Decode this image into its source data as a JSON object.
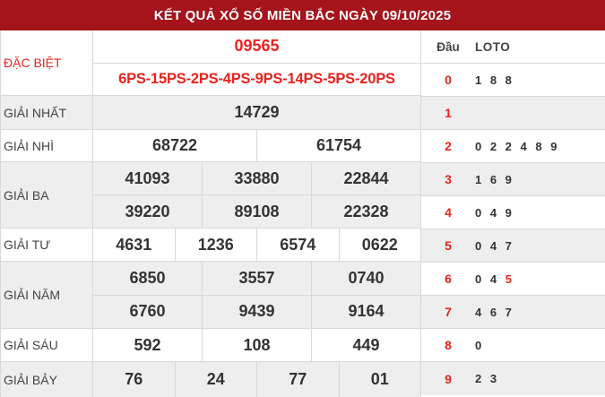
{
  "header": {
    "title": "KẾT QUẢ XỔ SỐ MIỀN BẮC NGÀY 09/10/2025"
  },
  "prizes": {
    "special": {
      "label": "ĐẶC BIỆT",
      "number": "09565",
      "codes": "6PS-15PS-2PS-4PS-9PS-14PS-5PS-20PS"
    },
    "first": {
      "label": "GIẢI NHẤT",
      "numbers": [
        "14729"
      ]
    },
    "second": {
      "label": "GIẢI NHÌ",
      "numbers": [
        "68722",
        "61754"
      ]
    },
    "third": {
      "label": "GIẢI BA",
      "numbers": [
        "41093",
        "33880",
        "22844",
        "39220",
        "89108",
        "22328"
      ]
    },
    "fourth": {
      "label": "GIẢI TƯ",
      "numbers": [
        "4631",
        "1236",
        "6574",
        "0622"
      ]
    },
    "fifth": {
      "label": "GIẢI NĂM",
      "numbers": [
        "6850",
        "3557",
        "0740",
        "6760",
        "9439",
        "9164"
      ]
    },
    "sixth": {
      "label": "GIẢI SÁU",
      "numbers": [
        "592",
        "108",
        "449"
      ]
    },
    "seventh": {
      "label": "GIẢI BẢY",
      "numbers": [
        "76",
        "24",
        "77",
        "01"
      ]
    }
  },
  "loto": {
    "head_label": "Đầu",
    "loto_label": "LOTO",
    "rows": [
      {
        "head": "0",
        "tails": "1 8 8"
      },
      {
        "head": "1",
        "tails": ""
      },
      {
        "head": "2",
        "tails": "0 2 2 4 8 9"
      },
      {
        "head": "3",
        "tails": "1 6 9"
      },
      {
        "head": "4",
        "tails": "0 4 9"
      },
      {
        "head": "5",
        "tails": "0 4 7"
      },
      {
        "head": "6",
        "tails": "0 4",
        "tails_highlight": " 5"
      },
      {
        "head": "7",
        "tails": "4 6 7"
      },
      {
        "head": "8",
        "tails": "0"
      },
      {
        "head": "9",
        "tails": "2 3"
      }
    ]
  },
  "colors": {
    "header_bg": "#a5141b",
    "accent_red": "#e8231e",
    "row_grey": "#eeeeee"
  }
}
